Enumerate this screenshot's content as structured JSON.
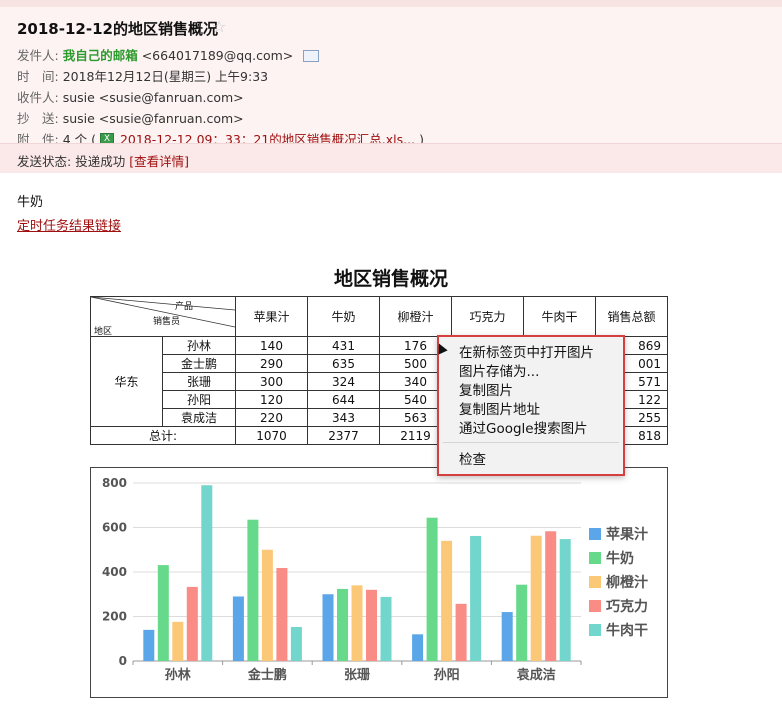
{
  "email": {
    "subject": "2018-12-12的地区销售概况",
    "star": "☆",
    "from_label": "发件人:",
    "from_name": "我自己的邮箱",
    "from_addr": "<664017189@qq.com>",
    "time_label": "时　间:",
    "time_value": "2018年12月12日(星期三) 上午9:33",
    "to_label": "收件人:",
    "to_value": "susie <susie@fanruan.com>",
    "cc_label": "抄　送:",
    "cc_value": "susie <susie@fanruan.com>",
    "attach_label": "附　件:",
    "attach_count": "4 个 (",
    "attach_name": "2018-12-12 09：33：21的地区销售概况汇总.xls...",
    "attach_close": ")",
    "status_label": "发送状态:",
    "status_value": "投递成功",
    "status_detail": "[查看详情]"
  },
  "body": {
    "text": "牛奶",
    "link": "定时任务结果链接"
  },
  "report": {
    "title": "地区销售概况",
    "corner": {
      "product": "产品",
      "salesperson": "销售员",
      "region": "地区"
    },
    "columns": [
      "苹果汁",
      "牛奶",
      "柳橙汁",
      "巧克力",
      "牛肉干",
      "销售总额"
    ],
    "region": "华东",
    "rows": [
      {
        "name": "孙林",
        "v": [
          "140",
          "431",
          "176",
          "",
          "",
          "869"
        ]
      },
      {
        "name": "金士鹏",
        "v": [
          "290",
          "635",
          "500",
          "",
          "",
          "001"
        ]
      },
      {
        "name": "张珊",
        "v": [
          "300",
          "324",
          "340",
          "",
          "",
          "571"
        ]
      },
      {
        "name": "孙阳",
        "v": [
          "120",
          "644",
          "540",
          "",
          "",
          "122"
        ]
      },
      {
        "name": "袁成洁",
        "v": [
          "220",
          "343",
          "563",
          "",
          "",
          "255"
        ]
      }
    ],
    "total_label": "总计:",
    "totals": [
      "1070",
      "2377",
      "2119",
      "",
      "",
      "818"
    ]
  },
  "context_menu": {
    "items": [
      "在新标签页中打开图片",
      "图片存储为...",
      "复制图片",
      "复制图片地址",
      "通过Google搜索图片"
    ],
    "inspect": "检查"
  },
  "colors": {
    "apple": "#5aa6e8",
    "milk": "#66d98a",
    "orange": "#fbc878",
    "choc": "#fa8c86",
    "jerky": "#72d6cc"
  },
  "chart_data": {
    "type": "bar",
    "categories": [
      "孙林",
      "金士鹏",
      "张珊",
      "孙阳",
      "袁成洁"
    ],
    "series": [
      {
        "name": "苹果汁",
        "color": "#5aa6e8",
        "values": [
          140,
          290,
          300,
          120,
          220
        ]
      },
      {
        "name": "牛奶",
        "color": "#66d98a",
        "values": [
          431,
          635,
          324,
          644,
          343
        ]
      },
      {
        "name": "柳橙汁",
        "color": "#fbc878",
        "values": [
          176,
          500,
          340,
          540,
          563
        ]
      },
      {
        "name": "巧克力",
        "color": "#fa8c86",
        "values": [
          333,
          418,
          320,
          257,
          583
        ]
      },
      {
        "name": "牛肉干",
        "color": "#72d6cc",
        "values": [
          790,
          153,
          288,
          562,
          548
        ]
      }
    ],
    "yticks": [
      "0",
      "200",
      "400",
      "600",
      "800"
    ],
    "ylim": [
      0,
      800
    ],
    "grid": true,
    "legend": "right"
  }
}
